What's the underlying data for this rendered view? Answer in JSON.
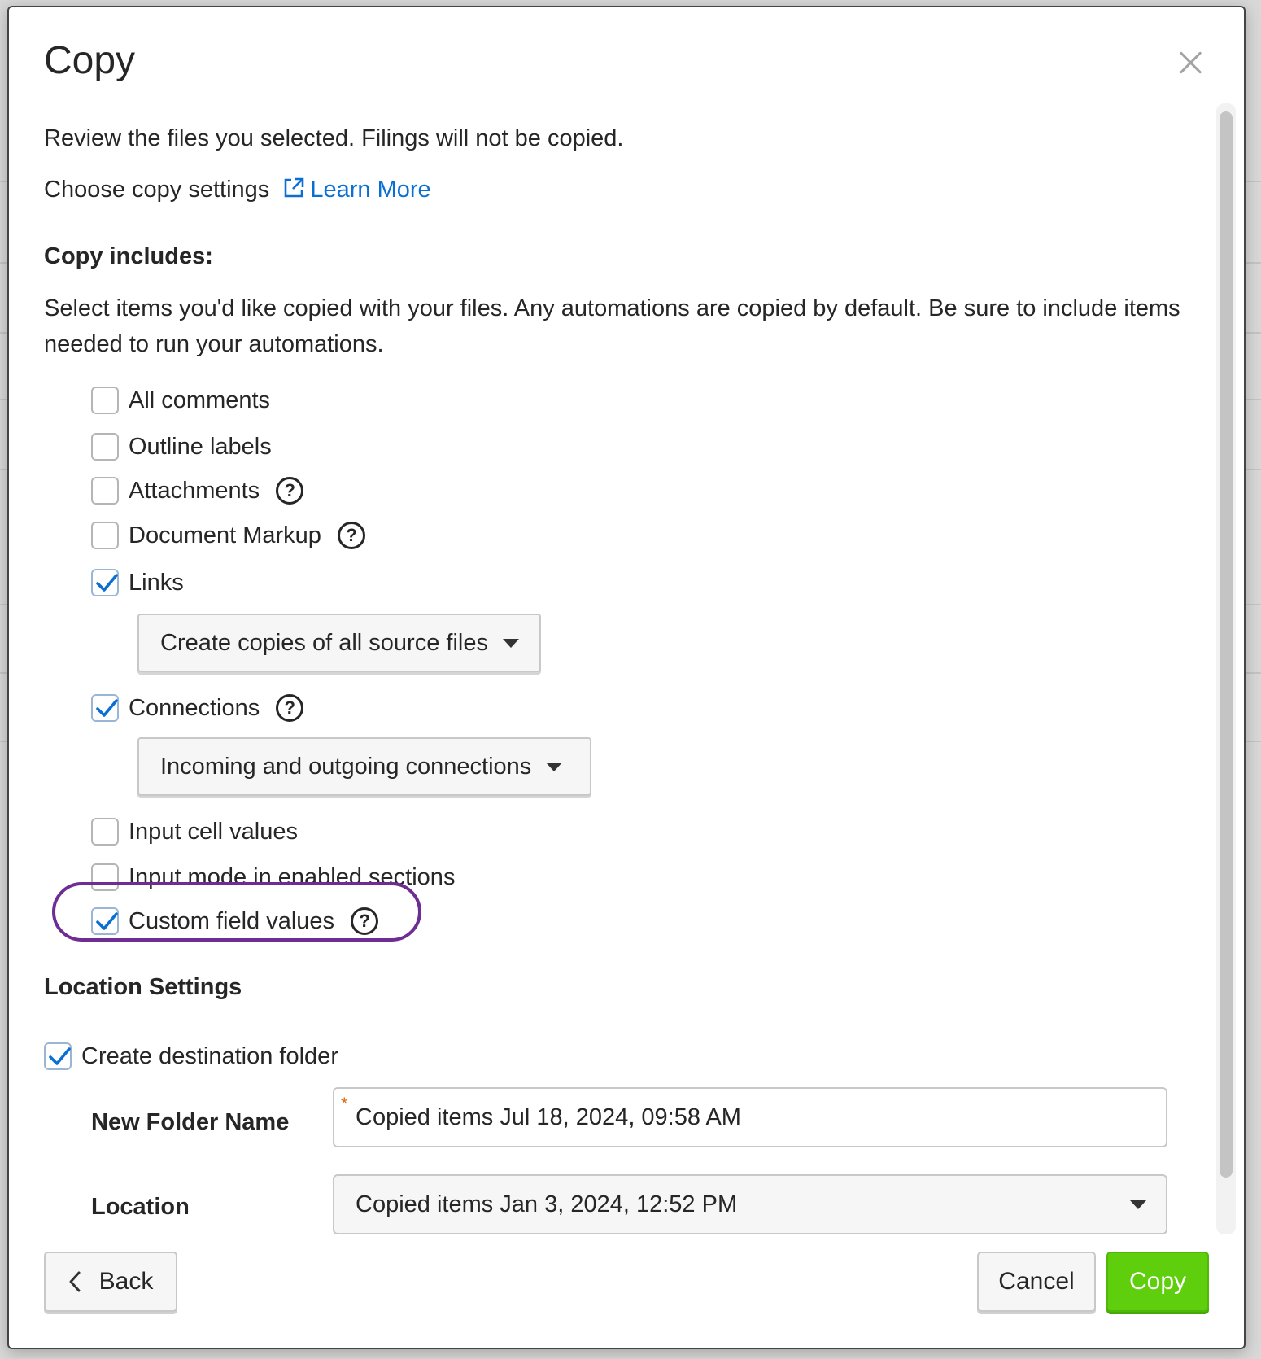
{
  "dialog": {
    "title": "Copy",
    "intro": "Review the files you selected. Filings will not be copied.",
    "settings_prompt": "Choose copy settings",
    "learn_more": "Learn More"
  },
  "includes": {
    "heading": "Copy includes:",
    "description": "Select items you'd like copied with your files. Any automations are copied by default. Be sure to include items needed to run your automations.",
    "items": [
      {
        "label": "All comments",
        "checked": false,
        "help": false
      },
      {
        "label": "Outline labels",
        "checked": false,
        "help": false
      },
      {
        "label": "Attachments",
        "checked": false,
        "help": true
      },
      {
        "label": "Document Markup",
        "checked": false,
        "help": true
      },
      {
        "label": "Links",
        "checked": true,
        "help": false
      },
      {
        "label": "Connections",
        "checked": true,
        "help": true
      },
      {
        "label": "Input cell values",
        "checked": false,
        "help": false
      },
      {
        "label": "Input mode in enabled sections",
        "checked": false,
        "help": false
      },
      {
        "label": "Custom field values",
        "checked": true,
        "help": true
      }
    ],
    "links_option": "Create copies of all source files",
    "connections_option": "Incoming and outgoing connections"
  },
  "location": {
    "heading": "Location Settings",
    "create_folder_label": "Create destination folder",
    "create_folder_checked": true,
    "folder_name_label": "New Folder Name",
    "folder_name_value": "Copied items Jul 18, 2024, 09:58 AM",
    "required_marker": "*",
    "location_label": "Location",
    "location_value": "Copied items Jan 3, 2024, 12:52 PM"
  },
  "footer": {
    "back": "Back",
    "cancel": "Cancel",
    "copy": "Copy"
  },
  "colors": {
    "link": "#0a6fd3",
    "primary": "#5fcf0d",
    "highlight": "#6e2d93",
    "required": "#e06a1b"
  }
}
